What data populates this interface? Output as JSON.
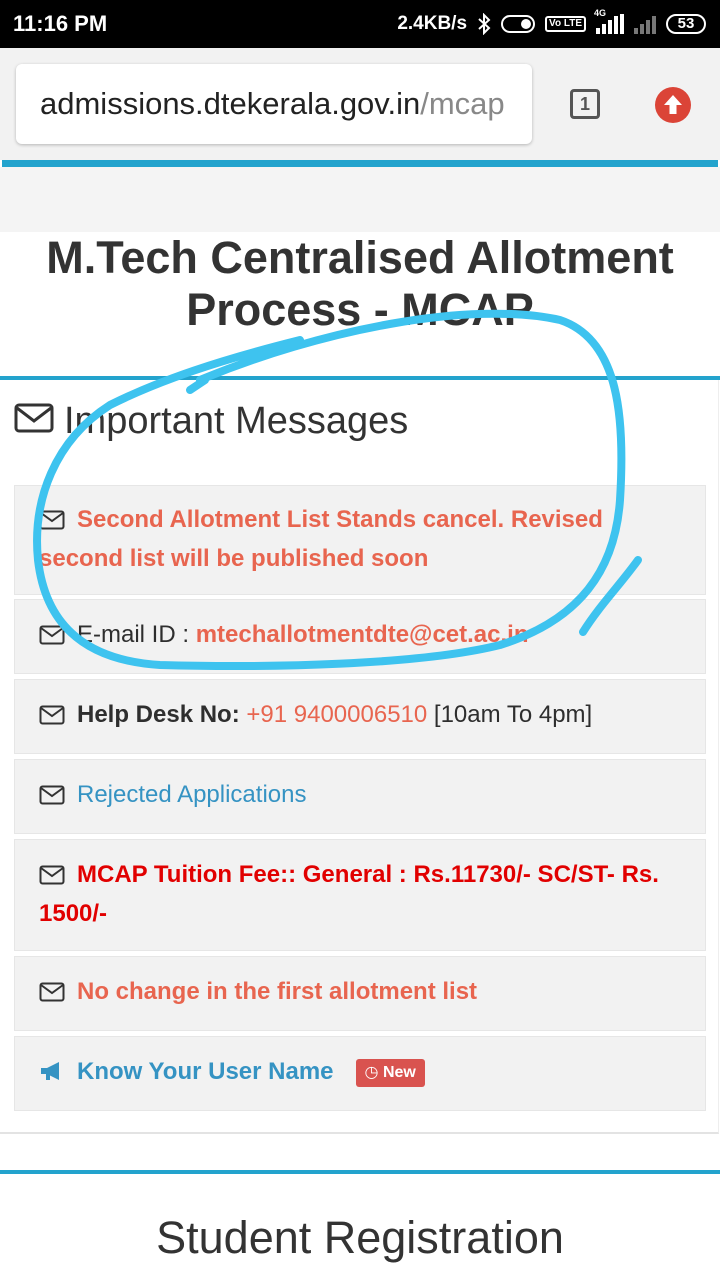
{
  "status_bar": {
    "time": "11:16 PM",
    "net_speed": "2.4KB/s",
    "signal_label": "4G",
    "volte_label": "Vo LTE",
    "battery": "53"
  },
  "browser": {
    "url_domain": "admissions.dtekerala.gov.in",
    "url_path": "/mcap",
    "tab_count": "1"
  },
  "page": {
    "title": "M.Tech Centralised Allotment Process - MCAP",
    "section_heading": "Important Messages",
    "messages": {
      "cancel_notice": "Second Allotment List Stands cancel. Revised second list will be published soon",
      "email_label": "E-mail ID :",
      "email_value": "mtechallotmentdte@cet.ac.in",
      "helpdesk_label": "Help Desk No:",
      "helpdesk_phone": "+91 9400006510",
      "helpdesk_hours": "[10am To 4pm]",
      "rejected": "Rejected Applications",
      "fee_notice": "MCAP Tuition Fee:: General : Rs.11730/- SC/ST- Rs. 1500/-",
      "no_change": "No change in the first allotment list",
      "know_username": "Know Your User Name",
      "new_badge": "New"
    },
    "next_section_title": "Student Registration"
  },
  "colors": {
    "accent": "#23a3cd",
    "message_red": "#e8654f",
    "fee_red": "#e10000",
    "link_blue": "#3593c3",
    "badge_red": "#d9534f",
    "scribble": "#3ec3ef"
  }
}
